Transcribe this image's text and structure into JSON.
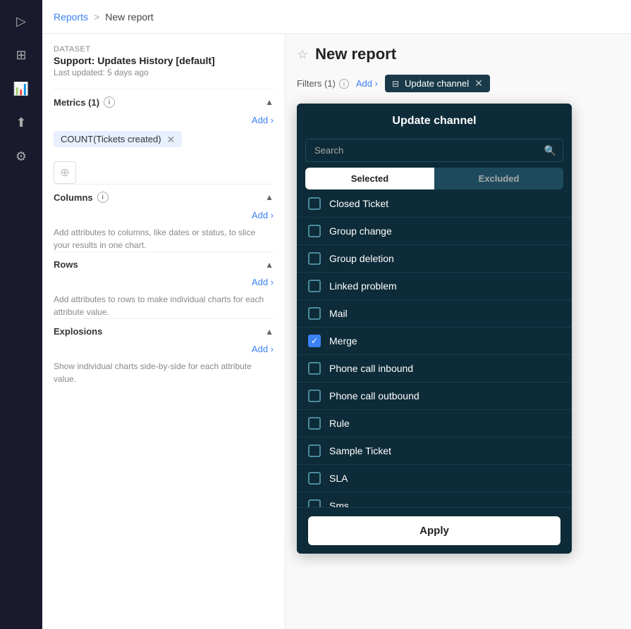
{
  "breadcrumb": {
    "link": "Reports",
    "separator": ">",
    "current": "New report"
  },
  "sidebar_icons": [
    {
      "name": "logo-icon",
      "symbol": "▷"
    },
    {
      "name": "dashboard-icon",
      "symbol": "⊞"
    },
    {
      "name": "chart-icon",
      "symbol": "📈"
    },
    {
      "name": "upload-icon",
      "symbol": "⬆"
    },
    {
      "name": "settings-icon",
      "symbol": "⚙"
    }
  ],
  "dataset": {
    "label": "Dataset",
    "name": "Support: Updates History [default]",
    "updated": "Last updated: 5 days ago"
  },
  "metrics_section": {
    "title": "Metrics (1)",
    "add_label": "Add ›",
    "chip_label": "COUNT(Tickets created)",
    "chart_icon": "⊕"
  },
  "columns_section": {
    "title": "Columns",
    "add_label": "Add ›",
    "desc": "Add attributes to columns, like dates or status, to slice your results in one chart."
  },
  "rows_section": {
    "title": "Rows",
    "add_label": "Add ›",
    "desc": "Add attributes to rows to make individual charts for each attribute value."
  },
  "explosions_section": {
    "title": "Explosions",
    "add_label": "Add ›",
    "desc": "Show individual charts side-by-side for each attribute value."
  },
  "report": {
    "title": "New report",
    "star_label": "☆"
  },
  "filters": {
    "label": "Filters (1)",
    "add_label": "Add ›",
    "chip_label": "Update channel",
    "chip_icon": "⊟"
  },
  "dropdown": {
    "title": "Update channel",
    "search_placeholder": "Search",
    "tab_selected": "Selected",
    "tab_excluded": "Excluded",
    "items": [
      {
        "label": "Closed Ticket",
        "checked": false
      },
      {
        "label": "Group change",
        "checked": false
      },
      {
        "label": "Group deletion",
        "checked": false
      },
      {
        "label": "Linked problem",
        "checked": false
      },
      {
        "label": "Mail",
        "checked": false
      },
      {
        "label": "Merge",
        "checked": true
      },
      {
        "label": "Phone call inbound",
        "checked": false
      },
      {
        "label": "Phone call outbound",
        "checked": false
      },
      {
        "label": "Rule",
        "checked": false
      },
      {
        "label": "Sample Ticket",
        "checked": false
      },
      {
        "label": "SLA",
        "checked": false
      },
      {
        "label": "Sms",
        "checked": false
      }
    ],
    "apply_label": "Apply"
  }
}
